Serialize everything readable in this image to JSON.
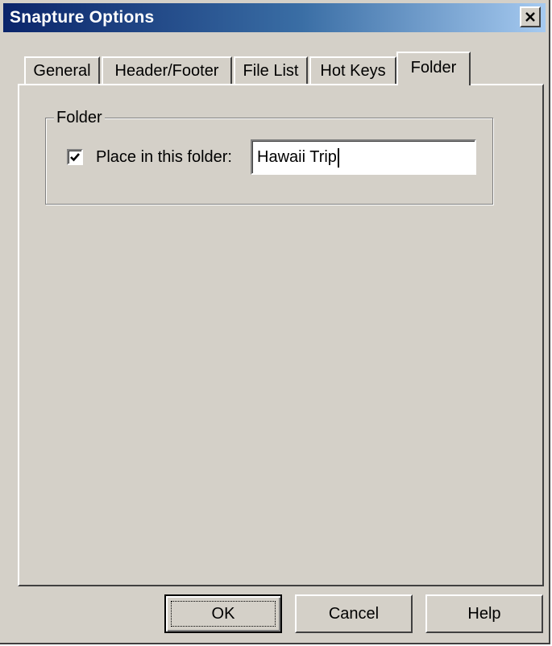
{
  "window": {
    "title": "Snapture Options"
  },
  "tabs": [
    {
      "label": "General",
      "active": false
    },
    {
      "label": "Header/Footer",
      "active": false
    },
    {
      "label": "File List",
      "active": false
    },
    {
      "label": "Hot Keys",
      "active": false
    },
    {
      "label": "Folder",
      "active": true
    }
  ],
  "folder_group": {
    "legend": "Folder",
    "checkbox_label": "Place in this folder:",
    "checkbox_checked": true,
    "folder_value": "Hawaii Trip"
  },
  "buttons": {
    "ok": "OK",
    "cancel": "Cancel",
    "help": "Help"
  },
  "icons": {
    "close": "close-icon",
    "check": "checkmark-icon"
  }
}
